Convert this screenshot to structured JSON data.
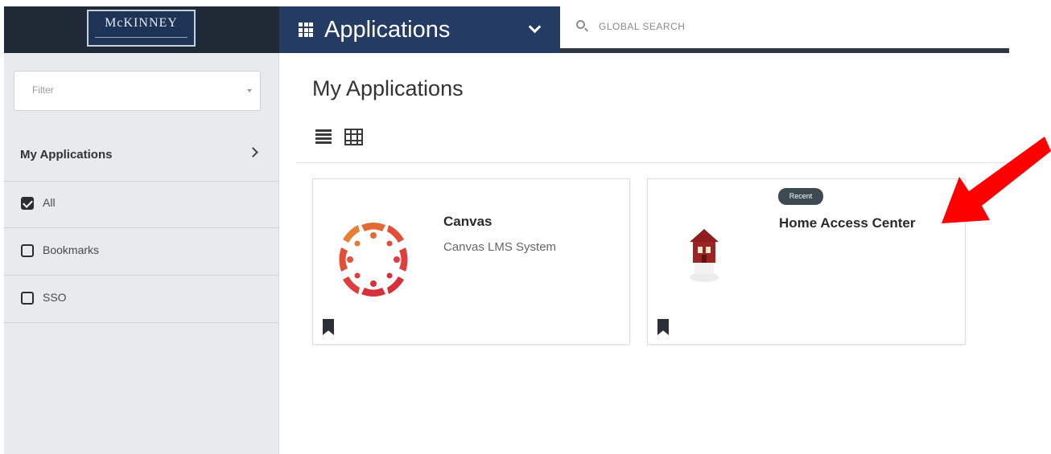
{
  "header": {
    "logo_text": "McKINNEY",
    "app_switcher_label": "Applications",
    "search_placeholder": "GLOBAL SEARCH"
  },
  "sidebar": {
    "filter_placeholder": "Filter",
    "section_title": "My Applications",
    "options": [
      {
        "label": "All",
        "checked": true
      },
      {
        "label": "Bookmarks",
        "checked": false
      },
      {
        "label": "SSO",
        "checked": false
      }
    ]
  },
  "main": {
    "title": "My Applications",
    "cards": [
      {
        "name": "Canvas",
        "description": "Canvas LMS System"
      },
      {
        "name": "Home Access Center",
        "badge": "Recent"
      }
    ]
  },
  "colors": {
    "header_dark": "#1f2a36",
    "header_blue": "#243c64",
    "sidebar_bg": "#e8eaec",
    "canvas_red": "#e0443a",
    "arrow_red": "#ff0000"
  },
  "icons": [
    "grid-icon",
    "chevron-down-icon",
    "search-icon",
    "chevron-right-icon",
    "list-view-icon",
    "grid-view-icon",
    "bookmark-icon",
    "canvas-logo",
    "home-access-center-logo",
    "red-arrow"
  ]
}
